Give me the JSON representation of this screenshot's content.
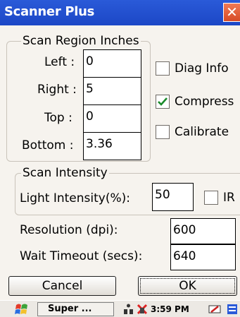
{
  "window": {
    "title": "Scanner Plus",
    "close_glyph": "✕"
  },
  "scan_region": {
    "legend": "Scan Region Inches",
    "left_label": "Left :",
    "left_value": "0",
    "right_label": "Right :",
    "right_value": "5",
    "top_label": "Top :",
    "top_value": "0",
    "bottom_label": "Bottom :",
    "bottom_value": "3.36"
  },
  "options": {
    "diag_info": {
      "label": "Diag Info",
      "checked": false
    },
    "compress": {
      "label": "Compress",
      "checked": true
    },
    "calibrate": {
      "label": "Calibrate",
      "checked": false
    }
  },
  "scan_intensity": {
    "legend": "Scan Intensity",
    "light_label": "Light Intensity(%):",
    "light_value": "50",
    "ir": {
      "label": "IR",
      "checked": false
    }
  },
  "resolution": {
    "label": "Resolution (dpi):",
    "value": "600"
  },
  "wait_timeout": {
    "label": "Wait Timeout (secs):",
    "value": "640"
  },
  "buttons": {
    "cancel": "Cancel",
    "ok": "OK"
  },
  "taskbar": {
    "start_icon": "windows-flag-icon",
    "task_label": "Super ...",
    "time": "3:59 PM",
    "tray_icons": [
      "network-icon",
      "status-icon",
      "keyboard-icon",
      "input-panel-icon"
    ]
  },
  "colors": {
    "title_bar": "#2a5ad8",
    "close_button": "#e05a35",
    "check_mark": "#1a8a2a"
  }
}
